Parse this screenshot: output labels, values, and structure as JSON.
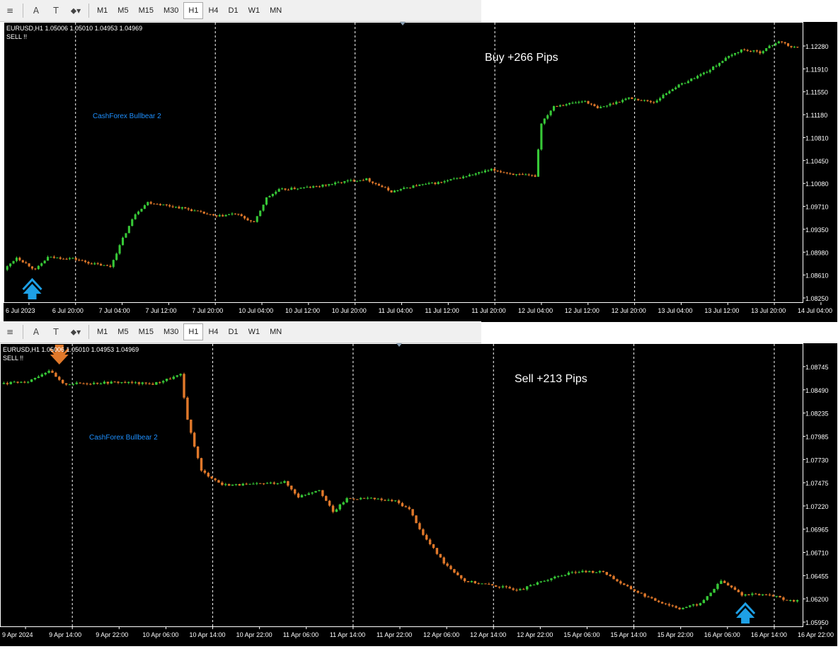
{
  "toolbar": {
    "icons": [
      "crosshair-lines-icon",
      "text-a-icon",
      "text-label-icon",
      "objects-dropdown-icon"
    ],
    "timeframes": [
      "M1",
      "M5",
      "M15",
      "M30",
      "H1",
      "H4",
      "D1",
      "W1",
      "MN"
    ],
    "active_timeframe": "H1"
  },
  "colors": {
    "bull": "#37c837",
    "bear": "#e0782a",
    "buy_arrow": "#1ea0e6",
    "sell_arrow": "#e0782a",
    "indicator_label": "#1e90ff"
  },
  "charts": [
    {
      "symbol_info": "EURUSD,H1  1.05006 1.05010 1.04953 1.04969",
      "signal": "SELL !!",
      "indicator": "CashForex Bullbear 2",
      "result": "Buy +266 Pips",
      "price_levels": [
        "1.12280",
        "1.11910",
        "1.11550",
        "1.11180",
        "1.10810",
        "1.10450",
        "1.10080",
        "1.09710",
        "1.09350",
        "1.08980",
        "1.08610",
        "1.08250"
      ],
      "time_labels": [
        "6 Jul 2023",
        "6 Jul 20:00",
        "7 Jul 04:00",
        "7 Jul 12:00",
        "7 Jul 20:00",
        "10 Jul 04:00",
        "10 Jul 12:00",
        "10 Jul 20:00",
        "11 Jul 04:00",
        "11 Jul 12:00",
        "11 Jul 20:00",
        "12 Jul 04:00",
        "12 Jul 12:00",
        "12 Jul 20:00",
        "13 Jul 04:00",
        "13 Jul 12:00",
        "13 Jul 20:00",
        "14 Jul 04:00"
      ],
      "chart_data": {
        "type": "candlestick",
        "symbol": "EURUSD",
        "timeframe": "H1",
        "ylim": [
          1.0825,
          1.1228
        ],
        "path": [
          [
            0,
            1.087
          ],
          [
            4,
            1.089
          ],
          [
            10,
            1.087
          ],
          [
            14,
            1.089
          ],
          [
            22,
            1.0888
          ],
          [
            28,
            1.088
          ],
          [
            34,
            1.0875
          ],
          [
            38,
            1.092
          ],
          [
            42,
            1.096
          ],
          [
            46,
            1.0978
          ],
          [
            58,
            1.0968
          ],
          [
            68,
            1.0955
          ],
          [
            74,
            1.096
          ],
          [
            80,
            1.0945
          ],
          [
            84,
            1.0985
          ],
          [
            88,
            1.0998
          ],
          [
            100,
            1.1003
          ],
          [
            110,
            1.1012
          ],
          [
            116,
            1.1015
          ],
          [
            124,
            1.0995
          ],
          [
            132,
            1.1005
          ],
          [
            140,
            1.101
          ],
          [
            148,
            1.102
          ],
          [
            156,
            1.103
          ],
          [
            164,
            1.1022
          ],
          [
            170,
            1.102
          ],
          [
            172,
            1.1105
          ],
          [
            176,
            1.1132
          ],
          [
            186,
            1.114
          ],
          [
            190,
            1.1128
          ],
          [
            200,
            1.1145
          ],
          [
            208,
            1.1138
          ],
          [
            214,
            1.116
          ],
          [
            220,
            1.1175
          ],
          [
            226,
            1.119
          ],
          [
            230,
            1.1205
          ],
          [
            236,
            1.1222
          ],
          [
            242,
            1.1218
          ],
          [
            248,
            1.1236
          ],
          [
            252,
            1.1226
          ]
        ],
        "candle_count": 254,
        "signals": [
          {
            "type": "buy",
            "index": 8
          }
        ]
      }
    },
    {
      "symbol_info": "EURUSD,H1  1.05006 1.05010 1.04953 1.04969",
      "signal": "SELL !!",
      "indicator": "CashForex Bullbear 2",
      "result": "Sell +213 Pips",
      "price_levels": [
        "1.08745",
        "1.08490",
        "1.08235",
        "1.07985",
        "1.07730",
        "1.07475",
        "1.07220",
        "1.06965",
        "1.06710",
        "1.06455",
        "1.06200",
        "1.05950"
      ],
      "time_labels": [
        "9 Apr 2024",
        "9 Apr 14:00",
        "9 Apr 22:00",
        "10 Apr 06:00",
        "10 Apr 14:00",
        "10 Apr 22:00",
        "11 Apr 06:00",
        "11 Apr 14:00",
        "11 Apr 22:00",
        "12 Apr 06:00",
        "12 Apr 14:00",
        "12 Apr 22:00",
        "15 Apr 06:00",
        "15 Apr 14:00",
        "15 Apr 22:00",
        "16 Apr 06:00",
        "16 Apr 14:00",
        "16 Apr 22:00"
      ],
      "chart_data": {
        "type": "candlestick",
        "symbol": "EURUSD",
        "timeframe": "H1",
        "ylim": [
          1.0595,
          1.0874
        ],
        "path": [
          [
            0,
            1.0855
          ],
          [
            8,
            1.0858
          ],
          [
            14,
            1.087
          ],
          [
            18,
            1.0855
          ],
          [
            26,
            1.0856
          ],
          [
            34,
            1.0857
          ],
          [
            44,
            1.0855
          ],
          [
            52,
            1.0865
          ],
          [
            54,
            1.0815
          ],
          [
            58,
            1.076
          ],
          [
            64,
            1.0745
          ],
          [
            72,
            1.0745
          ],
          [
            82,
            1.0748
          ],
          [
            86,
            1.0732
          ],
          [
            92,
            1.074
          ],
          [
            96,
            1.0715
          ],
          [
            100,
            1.073
          ],
          [
            106,
            1.073
          ],
          [
            114,
            1.0727
          ],
          [
            118,
            1.0718
          ],
          [
            122,
            1.069
          ],
          [
            128,
            1.066
          ],
          [
            134,
            1.064
          ],
          [
            142,
            1.0635
          ],
          [
            150,
            1.063
          ],
          [
            158,
            1.0642
          ],
          [
            166,
            1.065
          ],
          [
            174,
            1.065
          ],
          [
            180,
            1.0635
          ],
          [
            188,
            1.062
          ],
          [
            196,
            1.061
          ],
          [
            202,
            1.0615
          ],
          [
            208,
            1.064
          ],
          [
            214,
            1.0625
          ],
          [
            222,
            1.0625
          ],
          [
            228,
            1.0618
          ]
        ],
        "candle_count": 230,
        "signals": [
          {
            "type": "sell",
            "index": 16
          },
          {
            "type": "buy",
            "index": 214
          }
        ]
      }
    }
  ]
}
